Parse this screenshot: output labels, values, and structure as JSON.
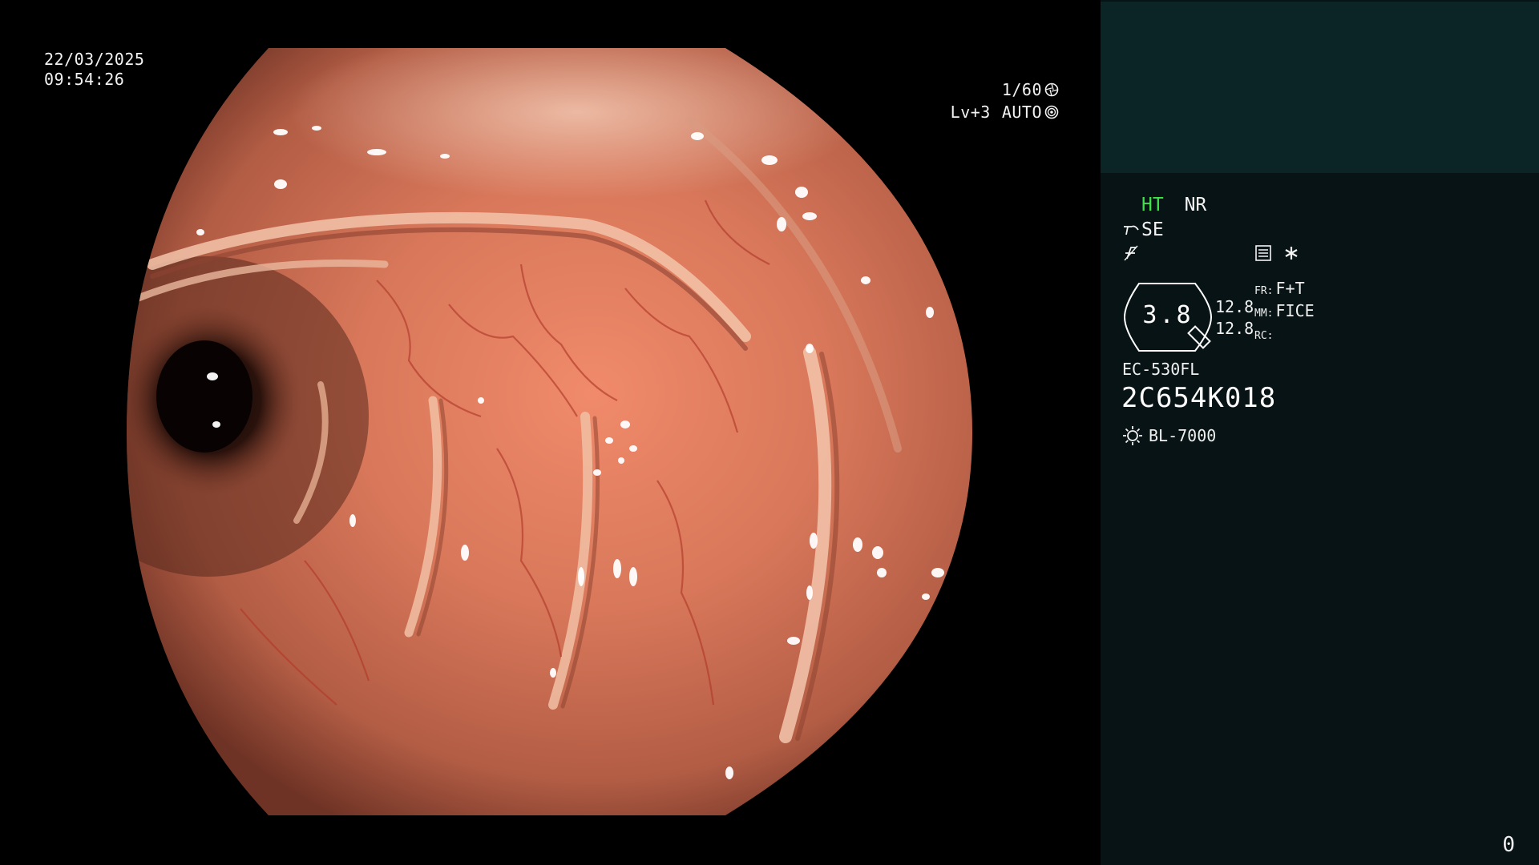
{
  "overlay": {
    "date": "22/03/2025",
    "time": "09:54:26",
    "shutter": "1/60",
    "shutter_icon": "aperture-icon",
    "level": "Lv+3",
    "mode": "AUTO",
    "mode_icon": "iris-icon"
  },
  "panel": {
    "ht": "HT",
    "nr": "NR",
    "se": "SE",
    "zoom": "3.8",
    "num1": "12.8",
    "num2": "12.8",
    "fr_key": "FR:",
    "fr_val": "F+T",
    "mm_key": "MM:",
    "mm_val": "FICE",
    "rc_key": "RC:",
    "rc_val": "",
    "scope_model": "EC-530FL",
    "scope_serial": "2C654K018",
    "light_source": "BL-7000",
    "counter": "0"
  },
  "colors": {
    "ht_green": "#3fe24a",
    "panel_bg": "#071314",
    "thumb_bg": "#0b2426",
    "mucosa": "#c8694f"
  }
}
